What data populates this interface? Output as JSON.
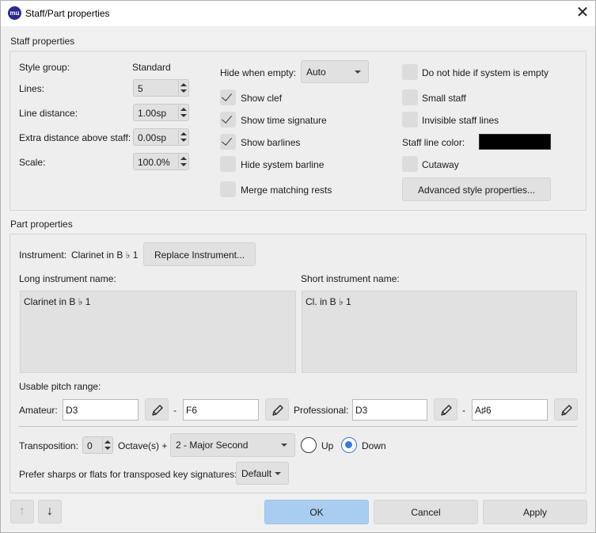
{
  "window": {
    "title": "Staff/Part properties",
    "app_icon_text": "mu",
    "close_glyph": "✕"
  },
  "staff": {
    "section_label": "Staff properties",
    "style_group_label": "Style group:",
    "style_group_value": "Standard",
    "lines_label": "Lines:",
    "lines_value": "5",
    "line_distance_label": "Line distance:",
    "line_distance_value": "1.00sp",
    "extra_distance_label": "Extra distance above staff:",
    "extra_distance_value": "0.00sp",
    "scale_label": "Scale:",
    "scale_value": "100.0%",
    "hide_when_empty_label": "Hide when empty:",
    "hide_when_empty_value": "Auto",
    "show_clef": {
      "label": "Show clef",
      "checked": true
    },
    "show_time_signature": {
      "label": "Show time signature",
      "checked": true
    },
    "show_barlines": {
      "label": "Show barlines",
      "checked": true
    },
    "hide_system_barline": {
      "label": "Hide system barline",
      "checked": false
    },
    "merge_matching_rests": {
      "label": "Merge matching rests",
      "checked": false
    },
    "do_not_hide": {
      "label": "Do not hide if system is empty",
      "checked": false
    },
    "small_staff": {
      "label": "Small staff",
      "checked": false
    },
    "invisible_staff_lines": {
      "label": "Invisible staff lines",
      "checked": false
    },
    "staff_line_color_label": "Staff line color:",
    "staff_line_color": "#000000",
    "cutaway": {
      "label": "Cutaway",
      "checked": false
    },
    "advanced_button": "Advanced style properties..."
  },
  "part": {
    "section_label": "Part properties",
    "instrument_label": "Instrument:",
    "instrument_value": "Clarinet in B ♭ 1",
    "replace_button": "Replace Instrument...",
    "long_name_label": "Long instrument name:",
    "long_name_value": "Clarinet in B ♭ 1",
    "short_name_label": "Short instrument name:",
    "short_name_value": "Cl. in B ♭ 1",
    "pitch_range_label": "Usable pitch range:",
    "amateur_label": "Amateur:",
    "amateur_low": "D3",
    "amateur_high": "F6",
    "professional_label": "Professional:",
    "professional_low": "D3",
    "professional_high": "A♯6",
    "dash": "-",
    "transposition_label": "Transposition:",
    "octave_value": "0",
    "octaves_label": "Octave(s) +",
    "interval_value": "2 - Major Second",
    "up_label": "Up",
    "down_label": "Down",
    "direction": "down",
    "prefer_label": "Prefer sharps or flats for transposed key signatures:",
    "prefer_value": "Default"
  },
  "footer": {
    "up_arrow": "↑",
    "down_arrow": "↓",
    "ok": "OK",
    "cancel": "Cancel",
    "apply": "Apply",
    "ok_color": "#a8cdf0"
  }
}
